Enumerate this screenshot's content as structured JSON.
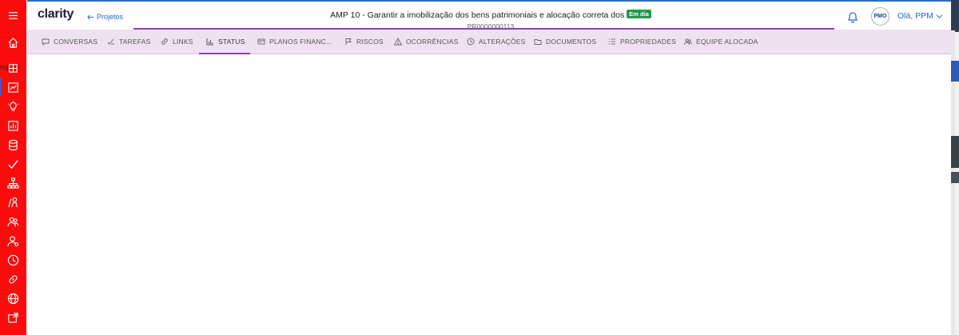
{
  "app": {
    "logo": "clarity"
  },
  "header": {
    "back_label": "Projetos",
    "title": "AMP 10 - Garantir a imobilização dos bens patrimoniais e alocação correta dos",
    "status_badge": "Em dia",
    "project_code": "PR0000000113",
    "avatar_text": "PMO",
    "user_greeting": "Olá, PPM"
  },
  "sidebar": {
    "tooltip": "rojeto",
    "items": [
      {
        "icon": "menu-icon"
      },
      {
        "icon": "home-icon"
      },
      {
        "icon": "projects-icon"
      },
      {
        "icon": "ideas-icon"
      },
      {
        "icon": "reports-icon"
      },
      {
        "icon": "database-icon"
      },
      {
        "icon": "check-icon"
      },
      {
        "icon": "hierarchy-icon"
      },
      {
        "icon": "resource-icon"
      },
      {
        "icon": "team-icon"
      },
      {
        "icon": "person-settings-icon"
      },
      {
        "icon": "clock-icon"
      },
      {
        "icon": "link-icon"
      },
      {
        "icon": "globe-icon"
      },
      {
        "icon": "export-icon"
      }
    ]
  },
  "tabs": [
    {
      "label": "CONVERSAS",
      "icon": "chat-icon"
    },
    {
      "label": "TAREFAS",
      "icon": "tasks-icon"
    },
    {
      "label": "LINKS",
      "icon": "link-icon"
    },
    {
      "label": "STATUS",
      "icon": "status-chart-icon",
      "active": true
    },
    {
      "label": "PLANOS FINANC...",
      "icon": "finance-icon"
    },
    {
      "label": "RISCOS",
      "icon": "flag-icon"
    },
    {
      "label": "OCORRÊNCIAS",
      "icon": "warning-icon"
    },
    {
      "label": "ALTERAÇÕES",
      "icon": "history-icon"
    },
    {
      "label": "DOCUMENTOS",
      "icon": "folder-icon"
    },
    {
      "label": "PROPRIEDADES",
      "icon": "list-icon"
    },
    {
      "label": "EQUIPE ALOCADA",
      "icon": "team-icon"
    }
  ],
  "colors": {
    "rail": "#fb0c0c",
    "accent": "#8e3fb0",
    "tab_bar": "#efe1f1",
    "badge": "#1e9b4a",
    "link": "#2a66c9"
  }
}
